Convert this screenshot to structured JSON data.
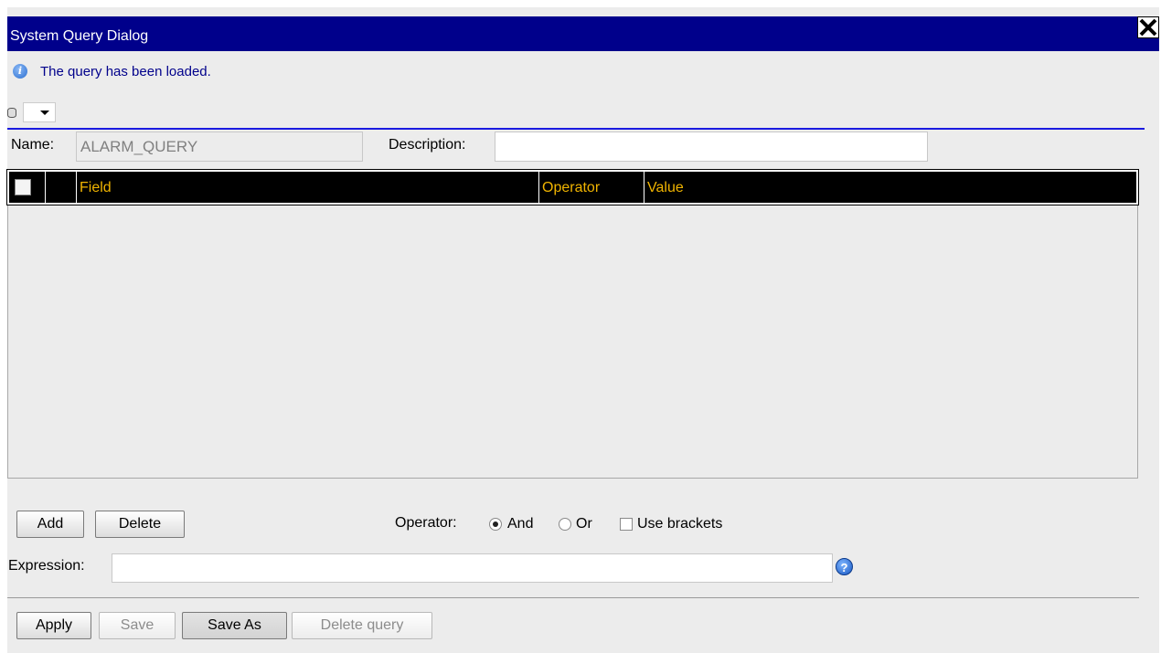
{
  "dialog": {
    "title": "System Query Dialog",
    "close_icon": "close-x-icon",
    "info": {
      "icon": "info-icon",
      "message": "The query has been loaded."
    }
  },
  "form": {
    "name_label": "Name:",
    "name_value": "ALARM_QUERY",
    "description_label": "Description:",
    "description_value": ""
  },
  "grid": {
    "columns": [
      "Field",
      "Operator",
      "Value"
    ],
    "rows": []
  },
  "actions": {
    "add_label": "Add",
    "delete_label": "Delete",
    "operator_label": "Operator:",
    "and_label": "And",
    "or_label": "Or",
    "selected_operator": "And",
    "use_brackets_label": "Use brackets",
    "use_brackets_checked": false
  },
  "expression": {
    "label": "Expression:",
    "value": ""
  },
  "footer": {
    "apply_label": "Apply",
    "save_label": "Save",
    "save_as_label": "Save As",
    "delete_query_label": "Delete query"
  },
  "colors": {
    "title_bar": "#00008b",
    "info_text": "#00008b",
    "grid_header_bg": "#000000",
    "grid_header_text": "#f0b400"
  }
}
